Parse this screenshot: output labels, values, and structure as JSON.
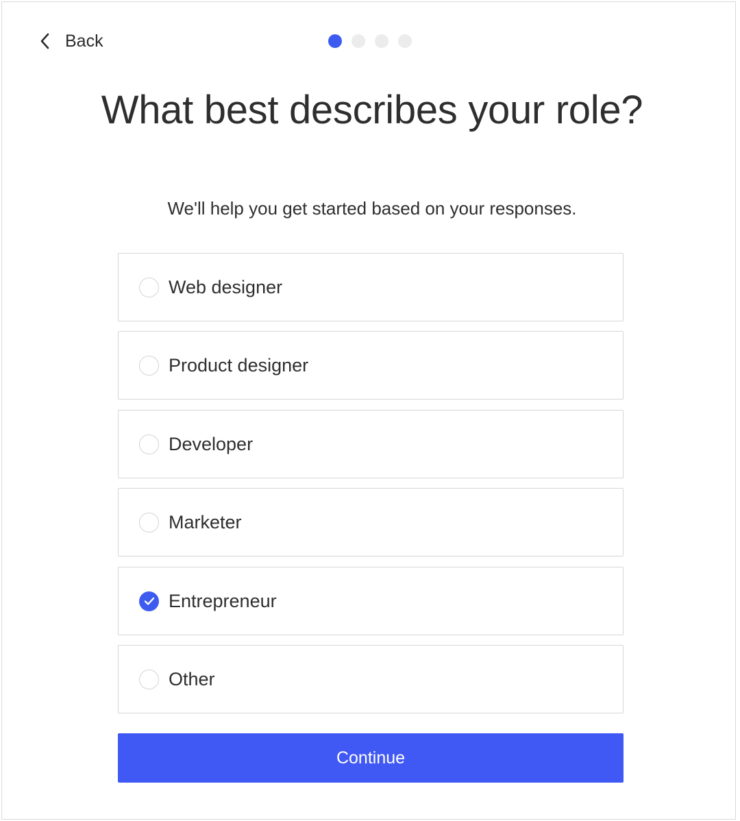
{
  "header": {
    "back_label": "Back",
    "back_icon": "chevron-left-icon",
    "steps": {
      "total": 4,
      "current": 1
    }
  },
  "main": {
    "title": "What best describes your role?",
    "subtitle": "We'll help you get started based on your responses."
  },
  "options": [
    {
      "label": "Web designer",
      "selected": false
    },
    {
      "label": "Product designer",
      "selected": false
    },
    {
      "label": "Developer",
      "selected": false
    },
    {
      "label": "Marketer",
      "selected": false
    },
    {
      "label": "Entrepreneur",
      "selected": true
    },
    {
      "label": "Other",
      "selected": false
    }
  ],
  "footer": {
    "continue_label": "Continue"
  },
  "colors": {
    "accent": "#4059f5",
    "inactive_dot": "#ececec",
    "border": "#d6d6d6",
    "text": "#2e2e2e"
  }
}
